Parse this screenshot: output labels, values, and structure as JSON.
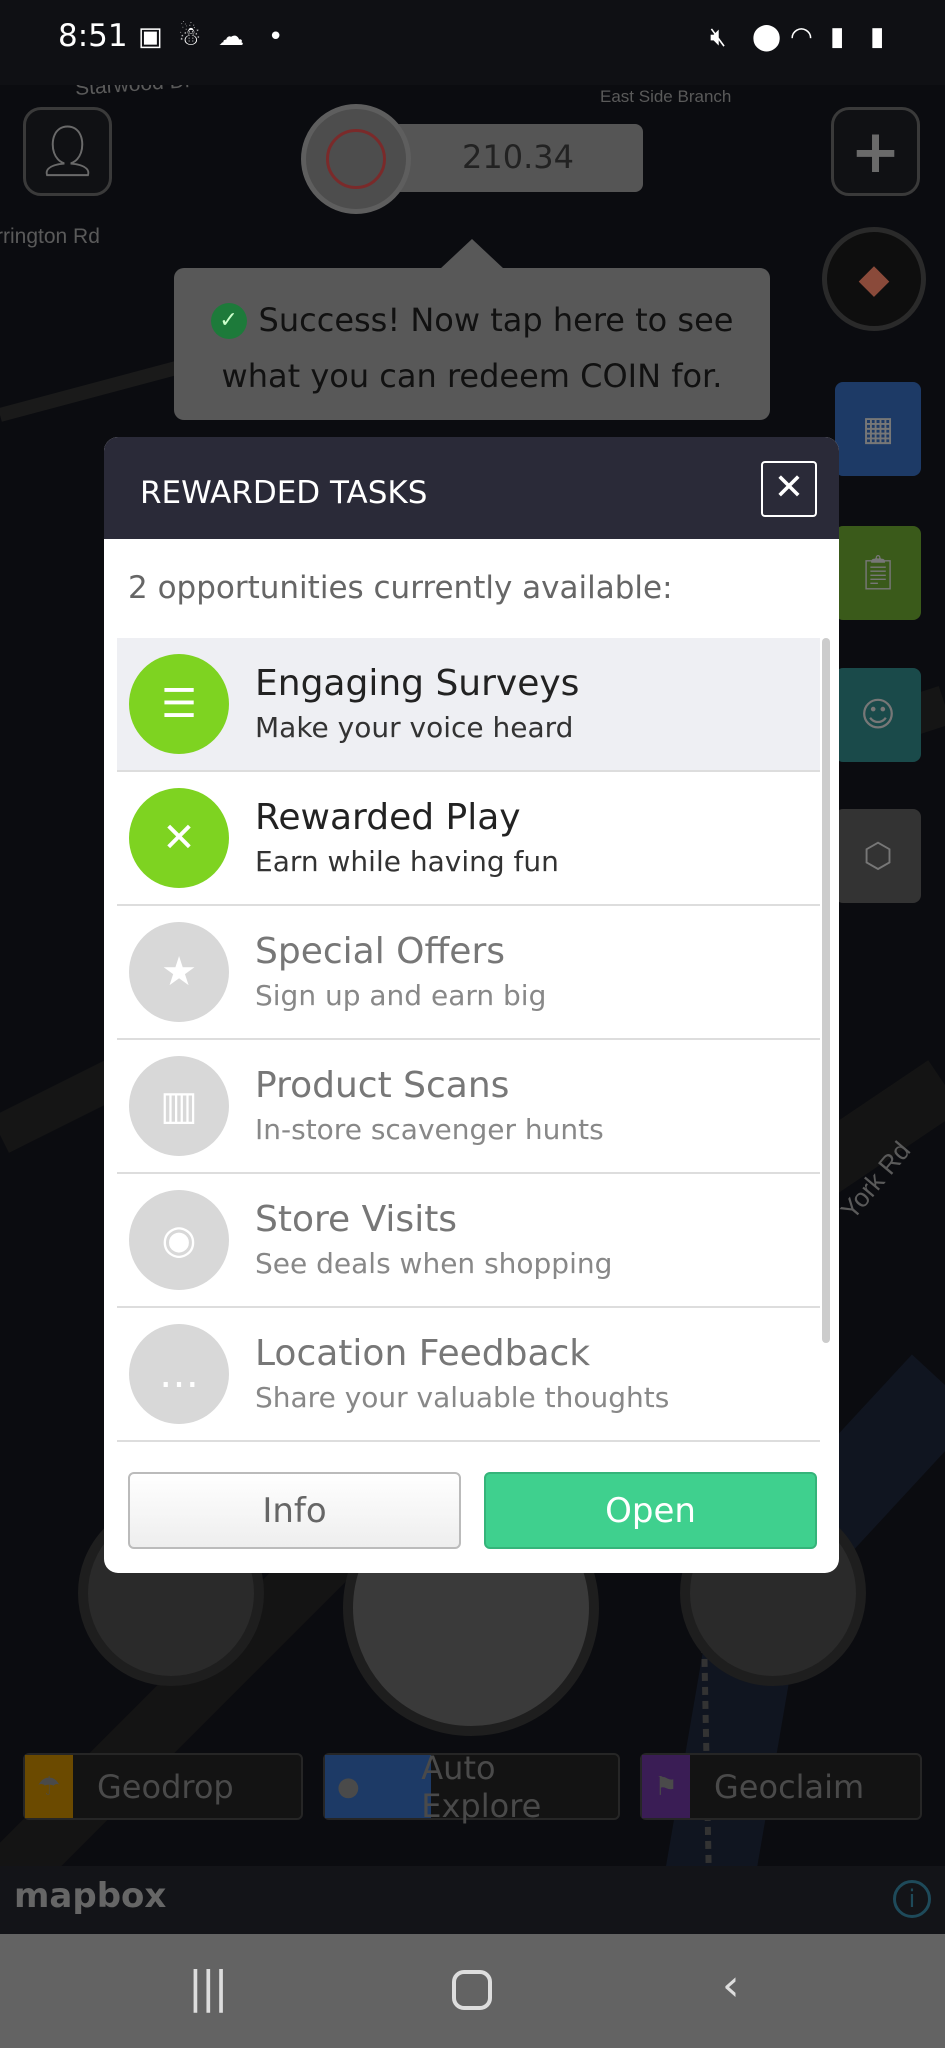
{
  "status_bar": {
    "time": "8:51",
    "left_icons": [
      "gallery-icon",
      "snapchat-icon",
      "cloud-icon",
      "dot-icon"
    ],
    "right_icons": [
      "mute-icon",
      "location-icon",
      "wifi-icon",
      "signal-icon",
      "battery-icon"
    ]
  },
  "map": {
    "labels": [
      "Starwood Dr",
      "Starwood Dr",
      "East Side Branch",
      "rrington Rd",
      "York Rd"
    ]
  },
  "coin": {
    "balance": "210.34"
  },
  "tooltip": {
    "text": "Success! Now tap here to see what you can redeem COIN for."
  },
  "modal": {
    "title": "REWARDED TASKS",
    "subtitle": "2 opportunities currently available:",
    "items": [
      {
        "title": "Engaging Surveys",
        "subtitle": "Make your voice heard",
        "icon": "clipboard-list-icon",
        "active": true,
        "color": "#7ed321"
      },
      {
        "title": "Rewarded Play",
        "subtitle": "Earn while having fun",
        "icon": "treasure-map-icon",
        "active": true,
        "color": "#7ed321"
      },
      {
        "title": "Special Offers",
        "subtitle": "Sign up and earn big",
        "icon": "star-badge-icon",
        "active": false,
        "color": "#d8d8d8"
      },
      {
        "title": "Product Scans",
        "subtitle": "In-store scavenger hunts",
        "icon": "barcode-icon",
        "active": false,
        "color": "#d8d8d8"
      },
      {
        "title": "Store Visits",
        "subtitle": "See deals when shopping",
        "icon": "map-pin-icon",
        "active": false,
        "color": "#d8d8d8"
      },
      {
        "title": "Location Feedback",
        "subtitle": "Share your valuable thoughts",
        "icon": "chat-bubble-icon",
        "active": false,
        "color": "#d8d8d8"
      }
    ],
    "info_label": "Info",
    "open_label": "Open"
  },
  "features": [
    {
      "label": "Geodrop",
      "color": "#6b4a00"
    },
    {
      "label": "Auto Explore",
      "color": "#1d3a66"
    },
    {
      "label": "Geoclaim",
      "color": "#3a1d55"
    }
  ],
  "mapbox": {
    "logo": "mapbox"
  }
}
